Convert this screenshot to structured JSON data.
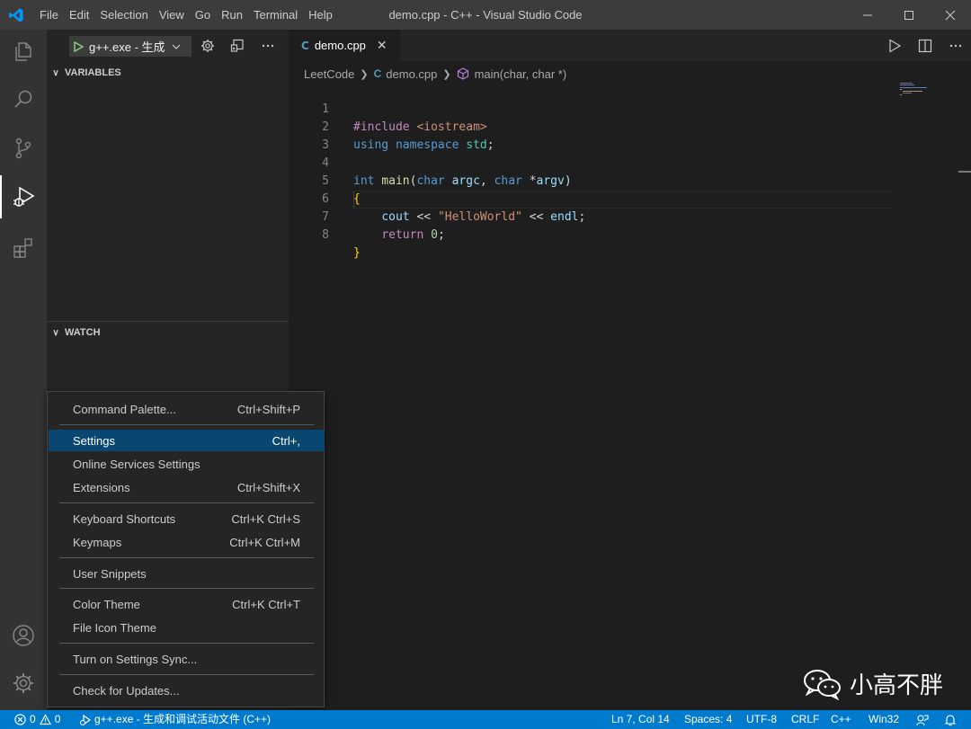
{
  "app": {
    "window_title": "demo.cpp - C++ - Visual Studio Code",
    "menu": [
      "File",
      "Edit",
      "Selection",
      "View",
      "Go",
      "Run",
      "Terminal",
      "Help"
    ]
  },
  "sidebar": {
    "run_config": "g++.exe - 生成",
    "sections": {
      "variables": "VARIABLES",
      "watch": "WATCH"
    }
  },
  "editor": {
    "tab_label": "demo.cpp",
    "breadcrumb": {
      "folder": "LeetCode",
      "file": "demo.cpp",
      "symbol": "main(char, char *)"
    },
    "line_numbers": [
      "1",
      "2",
      "3",
      "4",
      "5",
      "6",
      "7",
      "8"
    ],
    "code": {
      "l1_directive": "#include",
      "l1_header": "<iostream>",
      "l2_using": "using",
      "l2_namespace": "namespace",
      "l2_std": "std",
      "l2_semi": ";",
      "l4_int": "int",
      "l4_main": "main",
      "l4_paren": "(",
      "l4_char1": "char",
      "l4_argc": "argc",
      "l4_comma": ",",
      "l4_char2": "char",
      "l4_star": "*",
      "l4_argv": "argv",
      "l4_close": ")",
      "l5_open": "{",
      "l6_cout": "cout",
      "l6_op1": "<<",
      "l6_str": "\"HelloWorld\"",
      "l6_op2": "<<",
      "l6_endl": "endl",
      "l6_semi": ";",
      "l7_return": "return",
      "l7_zero": "0",
      "l7_semi": ";",
      "l8_close": "}"
    }
  },
  "context_menu": {
    "items": [
      {
        "label": "Command Palette...",
        "shortcut": "Ctrl+Shift+P"
      },
      {
        "label": "Settings",
        "shortcut": "Ctrl+,"
      },
      {
        "label": "Online Services Settings",
        "shortcut": ""
      },
      {
        "label": "Extensions",
        "shortcut": "Ctrl+Shift+X"
      },
      {
        "label": "Keyboard Shortcuts",
        "shortcut": "Ctrl+K Ctrl+S"
      },
      {
        "label": "Keymaps",
        "shortcut": "Ctrl+K Ctrl+M"
      },
      {
        "label": "User Snippets",
        "shortcut": ""
      },
      {
        "label": "Color Theme",
        "shortcut": "Ctrl+K Ctrl+T"
      },
      {
        "label": "File Icon Theme",
        "shortcut": ""
      },
      {
        "label": "Turn on Settings Sync...",
        "shortcut": ""
      },
      {
        "label": "Check for Updates...",
        "shortcut": ""
      }
    ],
    "selected": "Settings"
  },
  "statusbar": {
    "errors": "0",
    "warnings": "0",
    "debug_config": "g++.exe - 生成和调试活动文件 (C++)",
    "position": "Ln 7, Col 14",
    "spaces": "Spaces: 4",
    "encoding": "UTF-8",
    "eol": "CRLF",
    "language": "C++",
    "platform": "Win32"
  },
  "watermark": {
    "text": "小高不胖"
  },
  "colors": {
    "accent": "#007acc",
    "selection": "#094771",
    "titlebar": "#3c3c3c",
    "activitybar": "#333333",
    "sidebar": "#252526",
    "editor": "#1e1e1e"
  }
}
